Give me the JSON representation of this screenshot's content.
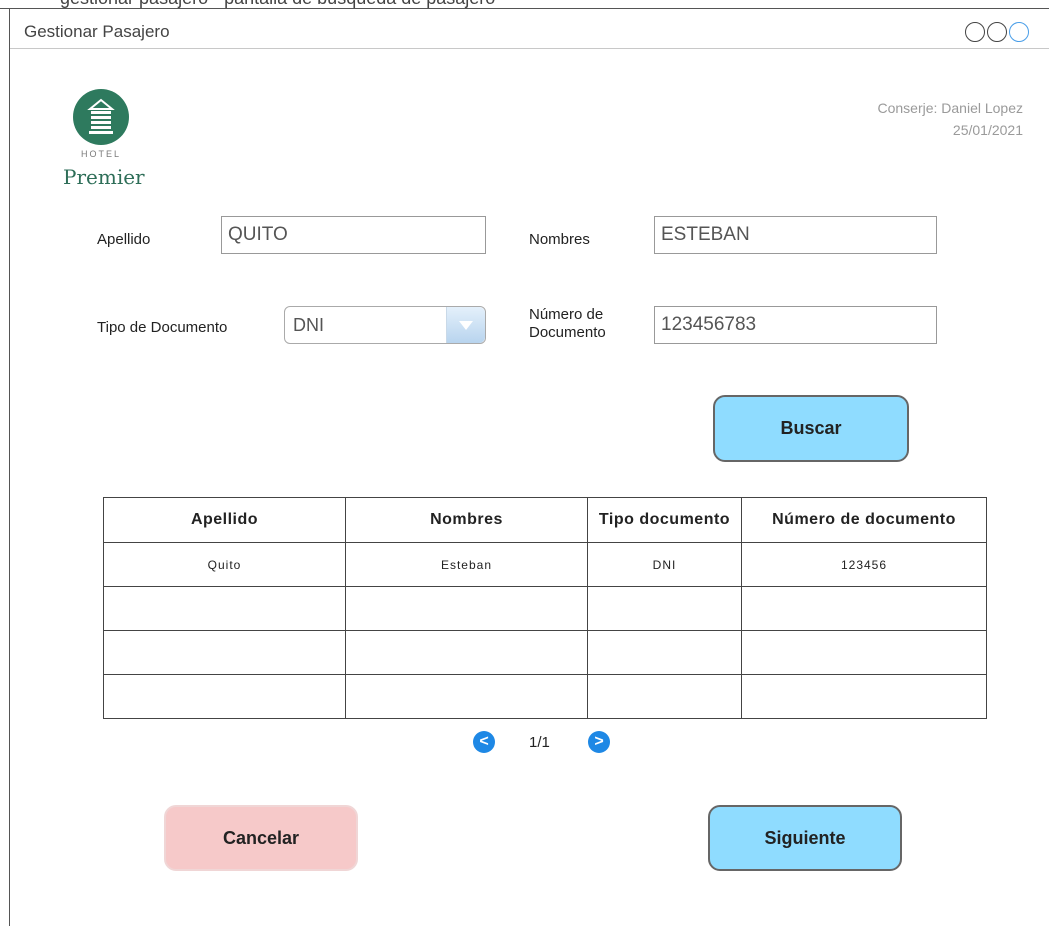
{
  "window": {
    "title": "Gestionar Pasajero"
  },
  "header": {
    "cut_title": "gestionar pasajero - pantalla de busqueda de pasajero",
    "concierge": "Conserje: Daniel Lopez",
    "date": "25/01/2021"
  },
  "logo": {
    "hotel": "HOTEL",
    "name": "Premier"
  },
  "form": {
    "apellido_label": "Apellido",
    "apellido_value": "QUITO",
    "nombres_label": "Nombres",
    "nombres_value": "ESTEBAN",
    "tipo_doc_label": "Tipo de Documento",
    "tipo_doc_value": "DNI",
    "num_doc_label_1": "Número de",
    "num_doc_label_2": "Documento",
    "num_doc_value": "123456783"
  },
  "buttons": {
    "buscar": "Buscar",
    "cancelar": "Cancelar",
    "siguiente": "Siguiente"
  },
  "table": {
    "headers": [
      "Apellido",
      "Nombres",
      "Tipo documento",
      "Número de documento"
    ],
    "rows": [
      [
        "Quito",
        "Esteban",
        "DNI",
        "123456"
      ],
      [
        "",
        "",
        "",
        ""
      ],
      [
        "",
        "",
        "",
        ""
      ],
      [
        "",
        "",
        "",
        ""
      ]
    ]
  },
  "pager": {
    "text": "1/1",
    "prev": "<",
    "next": ">"
  },
  "colors": {
    "accent_blue": "#8fdcff",
    "cancel_pink": "#f6c9c9",
    "logo_green": "#2e7a5e",
    "pager_blue": "#1e88e5"
  },
  "icons": [
    "hotel-logo-icon",
    "dropdown-arrow-icon",
    "prev-page-icon",
    "next-page-icon"
  ]
}
